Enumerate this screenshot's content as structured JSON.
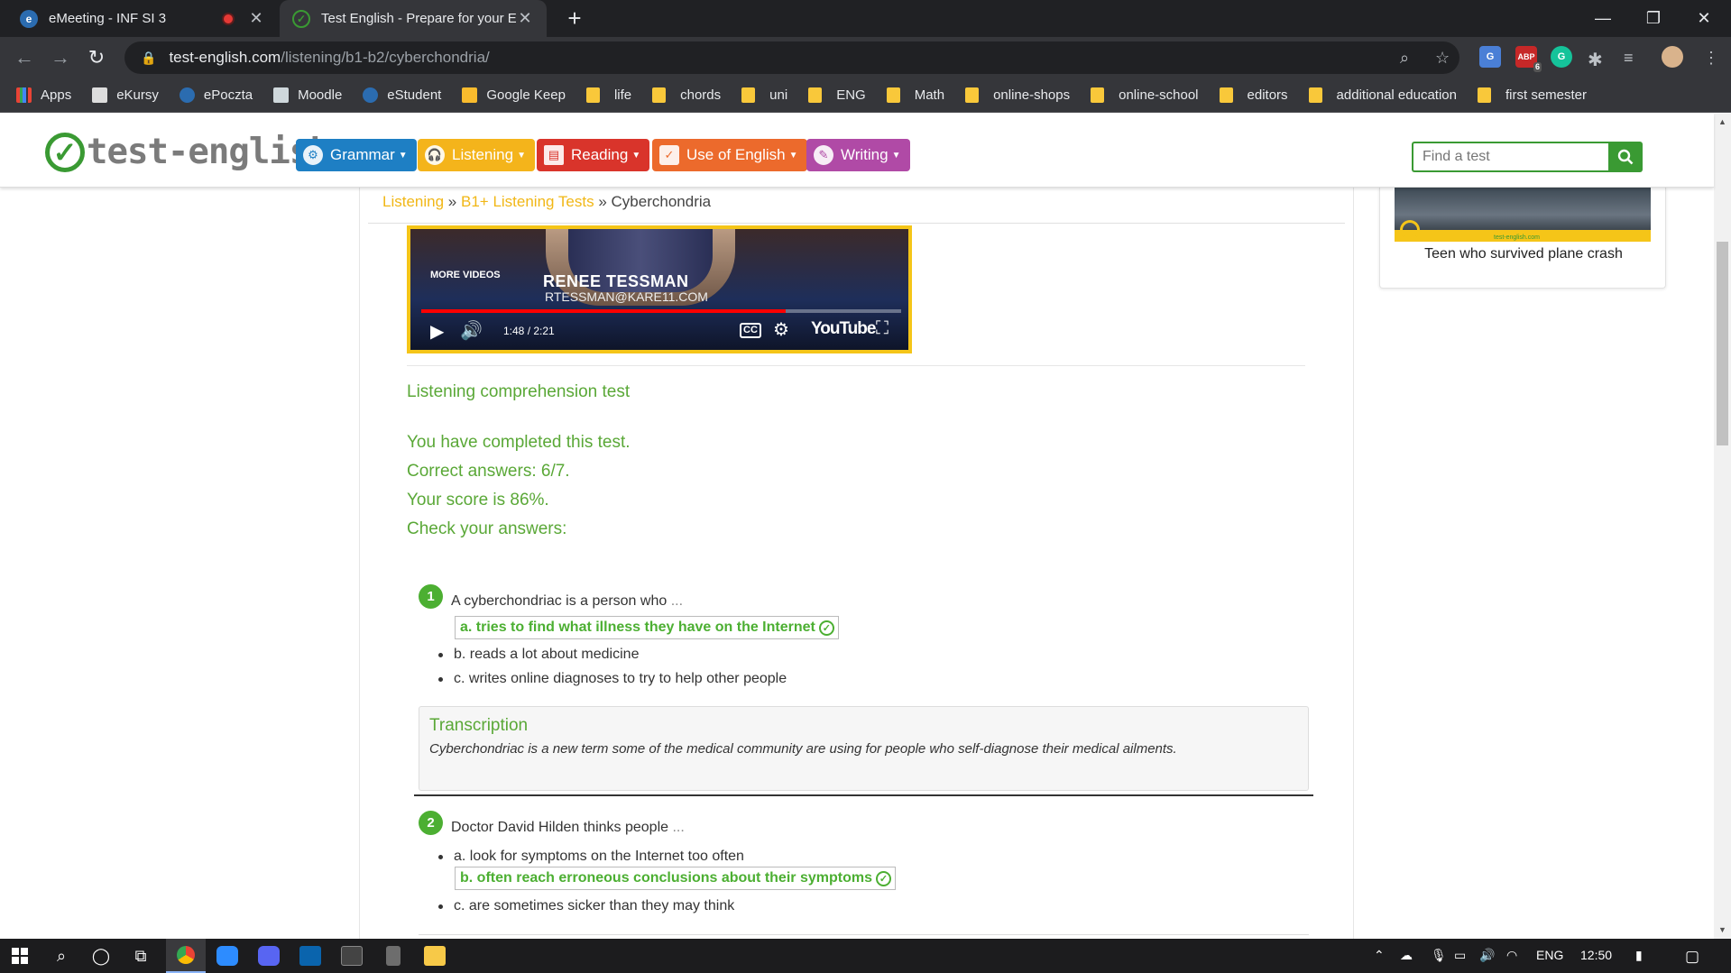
{
  "browser": {
    "tabs": [
      {
        "title": "eMeeting - INF SI 3",
        "active": false,
        "recording": true
      },
      {
        "title": "Test English - Prepare for your En",
        "active": true,
        "recording": false
      }
    ],
    "url_host": "test-english.com",
    "url_path": "/listening/b1-b2/cyberchondria/",
    "bookmarks": [
      "Apps",
      "eKursy",
      "ePoczta",
      "Moodle",
      "eStudent",
      "Google Keep",
      "life",
      "chords",
      "uni",
      "ENG",
      "Math",
      "online-shops",
      "online-school",
      "editors",
      "additional education",
      "first semester"
    ],
    "extension_badge": "6",
    "ext_abp_label": "ABP"
  },
  "site": {
    "logo_text": "test-english",
    "nav": [
      {
        "label": "Grammar",
        "color": "#1e7fc4",
        "icon": "gear-icon"
      },
      {
        "label": "Listening",
        "color": "#f4b41b",
        "icon": "headphones-icon"
      },
      {
        "label": "Reading",
        "color": "#d9342b",
        "icon": "document-icon"
      },
      {
        "label": "Use of English",
        "color": "#ec6a2c",
        "icon": "clipboard-check-icon"
      },
      {
        "label": "Writing",
        "color": "#b04aa6",
        "icon": "pen-icon"
      }
    ],
    "search_placeholder": "Find a test"
  },
  "breadcrumb": {
    "items": [
      "Listening",
      "B1+ Listening Tests"
    ],
    "separator": "»",
    "current": "Cyberchondria"
  },
  "video": {
    "more_videos": "MORE VIDEOS",
    "name": "RENEE TESSMAN",
    "email": "RTESSMAN@KARE11.COM",
    "time": "1:48 / 2:21",
    "progress_fraction": 0.76,
    "brand": "YouTube",
    "cc_label": "CC"
  },
  "test": {
    "title": "Listening comprehension test",
    "completed": "You have completed this test.",
    "correct": "Correct answers: 6/7.",
    "score": "Your score is 86%.",
    "check": "Check your answers:"
  },
  "questions": [
    {
      "num": "1",
      "text": "A cyberchondriac is a person who",
      "dots": "...",
      "options": [
        {
          "label": "a. tries to find what illness they have on the Internet",
          "correct": true
        },
        {
          "label": "b. reads a lot about medicine",
          "correct": false
        },
        {
          "label": "c. writes online diagnoses to try to help other people",
          "correct": false
        }
      ]
    },
    {
      "num": "2",
      "text": "Doctor David Hilden thinks people",
      "dots": "...",
      "options": [
        {
          "label": "a. look for symptoms on the Internet too often",
          "correct": false
        },
        {
          "label": "b. often reach erroneous conclusions about their symptoms",
          "correct": true
        },
        {
          "label": "c. are sometimes sicker than they may think",
          "correct": false
        }
      ]
    }
  ],
  "transcription": {
    "heading": "Transcription",
    "body": "Cyberchondriac is a new term some of the medical community are using for people who self-diagnose their medical ailments."
  },
  "sidebar": {
    "caption": "Teen who survived plane crash",
    "thumb_band_text": "test-english.com"
  },
  "taskbar": {
    "language": "ENG",
    "time": "12:50"
  }
}
